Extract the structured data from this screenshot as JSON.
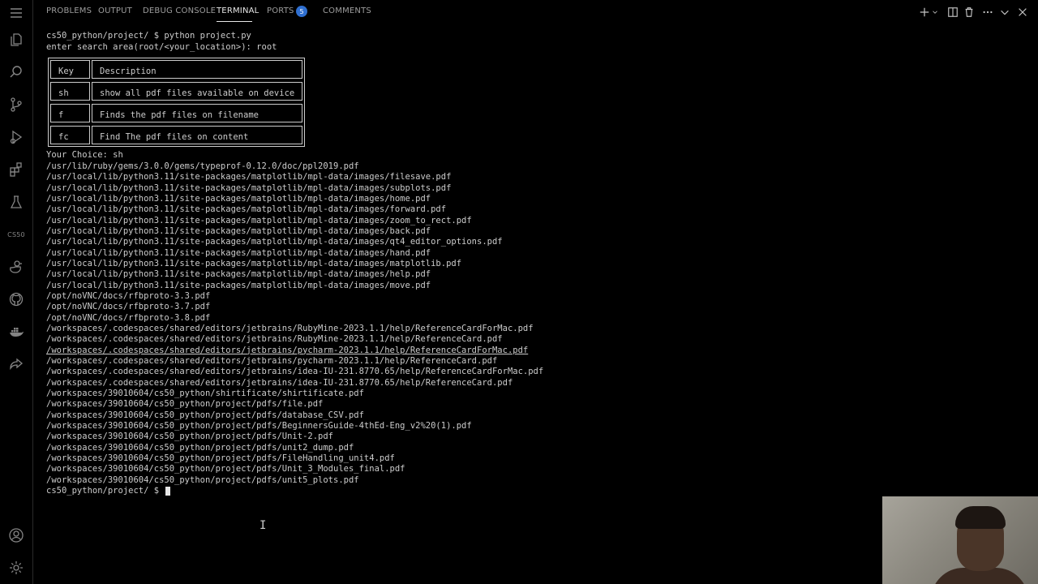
{
  "panel": {
    "tabs": [
      {
        "label": "PROBLEMS"
      },
      {
        "label": "OUTPUT"
      },
      {
        "label": "DEBUG CONSOLE"
      },
      {
        "label": "TERMINAL",
        "active": true
      },
      {
        "label": "PORTS",
        "badge": "5"
      },
      {
        "label": "COMMENTS"
      }
    ],
    "actions": [
      "add-icon",
      "chevron-down-icon",
      "split-icon",
      "trash-icon",
      "more-icon",
      "collapse-icon",
      "close-icon"
    ]
  },
  "activity_bar": {
    "items": [
      "menu-icon",
      "explorer-icon",
      "search-icon",
      "source-control-icon",
      "run-debug-icon",
      "extensions-icon",
      "testing-icon",
      "cs50-icon",
      "duck-icon",
      "github-icon",
      "docker-icon",
      "live-share-icon"
    ],
    "cs50_label": "CS50",
    "bottom_items": [
      "account-icon",
      "settings-icon"
    ]
  },
  "terminal": {
    "command_line": "cs50_python/project/ $ python project.py",
    "search_prompt": "enter search area(root/<your_location>): root",
    "table": {
      "headers": [
        "Key",
        "Description"
      ],
      "rows": [
        [
          "sh",
          "show all pdf files available on device"
        ],
        [
          "f",
          "Finds the pdf files on filename"
        ],
        [
          "fc",
          "Find The pdf files on content"
        ]
      ]
    },
    "choice_line": "Your Choice: sh",
    "results": [
      "/usr/lib/ruby/gems/3.0.0/gems/typeprof-0.12.0/doc/ppl2019.pdf",
      "/usr/local/lib/python3.11/site-packages/matplotlib/mpl-data/images/filesave.pdf",
      "/usr/local/lib/python3.11/site-packages/matplotlib/mpl-data/images/subplots.pdf",
      "/usr/local/lib/python3.11/site-packages/matplotlib/mpl-data/images/home.pdf",
      "/usr/local/lib/python3.11/site-packages/matplotlib/mpl-data/images/forward.pdf",
      "/usr/local/lib/python3.11/site-packages/matplotlib/mpl-data/images/zoom_to_rect.pdf",
      "/usr/local/lib/python3.11/site-packages/matplotlib/mpl-data/images/back.pdf",
      "/usr/local/lib/python3.11/site-packages/matplotlib/mpl-data/images/qt4_editor_options.pdf",
      "/usr/local/lib/python3.11/site-packages/matplotlib/mpl-data/images/hand.pdf",
      "/usr/local/lib/python3.11/site-packages/matplotlib/mpl-data/images/matplotlib.pdf",
      "/usr/local/lib/python3.11/site-packages/matplotlib/mpl-data/images/help.pdf",
      "/usr/local/lib/python3.11/site-packages/matplotlib/mpl-data/images/move.pdf",
      "/opt/noVNC/docs/rfbproto-3.3.pdf",
      "/opt/noVNC/docs/rfbproto-3.7.pdf",
      "/opt/noVNC/docs/rfbproto-3.8.pdf",
      "/workspaces/.codespaces/shared/editors/jetbrains/RubyMine-2023.1.1/help/ReferenceCardForMac.pdf",
      "/workspaces/.codespaces/shared/editors/jetbrains/RubyMine-2023.1.1/help/ReferenceCard.pdf",
      "/workspaces/.codespaces/shared/editors/jetbrains/pycharm-2023.1.1/help/ReferenceCardForMac.pdf",
      "/workspaces/.codespaces/shared/editors/jetbrains/pycharm-2023.1.1/help/ReferenceCard.pdf",
      "/workspaces/.codespaces/shared/editors/jetbrains/idea-IU-231.8770.65/help/ReferenceCardForMac.pdf",
      "/workspaces/.codespaces/shared/editors/jetbrains/idea-IU-231.8770.65/help/ReferenceCard.pdf",
      "/workspaces/39010604/cs50_python/shirtificate/shirtificate.pdf",
      "/workspaces/39010604/cs50_python/project/pdfs/file.pdf",
      "/workspaces/39010604/cs50_python/project/pdfs/database_CSV.pdf",
      "/workspaces/39010604/cs50_python/project/pdfs/BeginnersGuide-4thEd-Eng_v2%20(1).pdf",
      "/workspaces/39010604/cs50_python/project/pdfs/Unit-2.pdf",
      "/workspaces/39010604/cs50_python/project/pdfs/unit2_dump.pdf",
      "/workspaces/39010604/cs50_python/project/pdfs/FileHandling_unit4.pdf",
      "/workspaces/39010604/cs50_python/project/pdfs/Unit_3_Modules_final.pdf",
      "/workspaces/39010604/cs50_python/project/pdfs/unit5_plots.pdf"
    ],
    "final_prompt": "cs50_python/project/ $ "
  }
}
